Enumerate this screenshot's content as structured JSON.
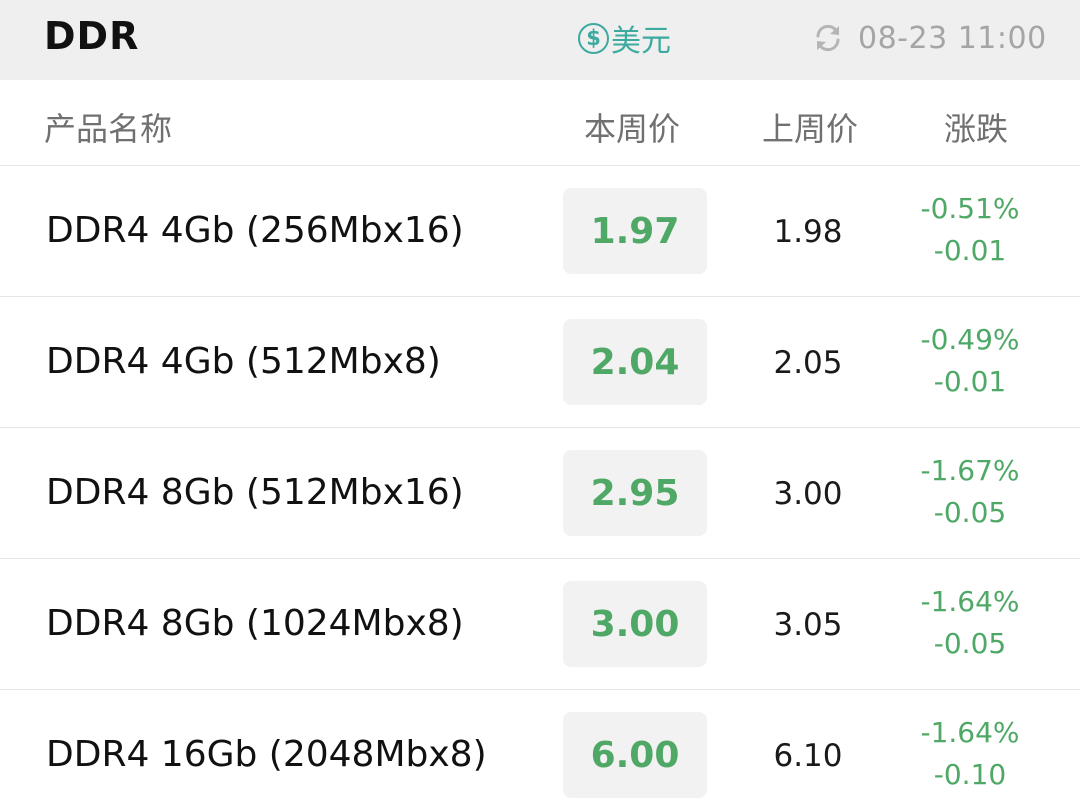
{
  "header": {
    "title": "DDR",
    "currency_label": "美元",
    "currency_icon": "dollar-circle-icon",
    "refresh_icon": "refresh-icon",
    "timestamp": "08-23 11:00"
  },
  "columns": {
    "name": "产品名称",
    "this_week": "本周价",
    "last_week": "上周价",
    "change": "涨跌"
  },
  "colors": {
    "accent": "#3daaa0",
    "down": "#4fa866"
  },
  "rows": [
    {
      "name": "DDR4 4Gb (256Mbx16)",
      "this_week": "1.97",
      "last_week": "1.98",
      "change_pct": "-0.51%",
      "change_abs": "-0.01"
    },
    {
      "name": "DDR4 4Gb (512Mbx8)",
      "this_week": "2.04",
      "last_week": "2.05",
      "change_pct": "-0.49%",
      "change_abs": "-0.01"
    },
    {
      "name": "DDR4 8Gb (512Mbx16)",
      "this_week": "2.95",
      "last_week": "3.00",
      "change_pct": "-1.67%",
      "change_abs": "-0.05"
    },
    {
      "name": "DDR4 8Gb (1024Mbx8)",
      "this_week": "3.00",
      "last_week": "3.05",
      "change_pct": "-1.64%",
      "change_abs": "-0.05"
    },
    {
      "name": "DDR4 16Gb (2048Mbx8)",
      "this_week": "6.00",
      "last_week": "6.10",
      "change_pct": "-1.64%",
      "change_abs": "-0.10"
    }
  ]
}
